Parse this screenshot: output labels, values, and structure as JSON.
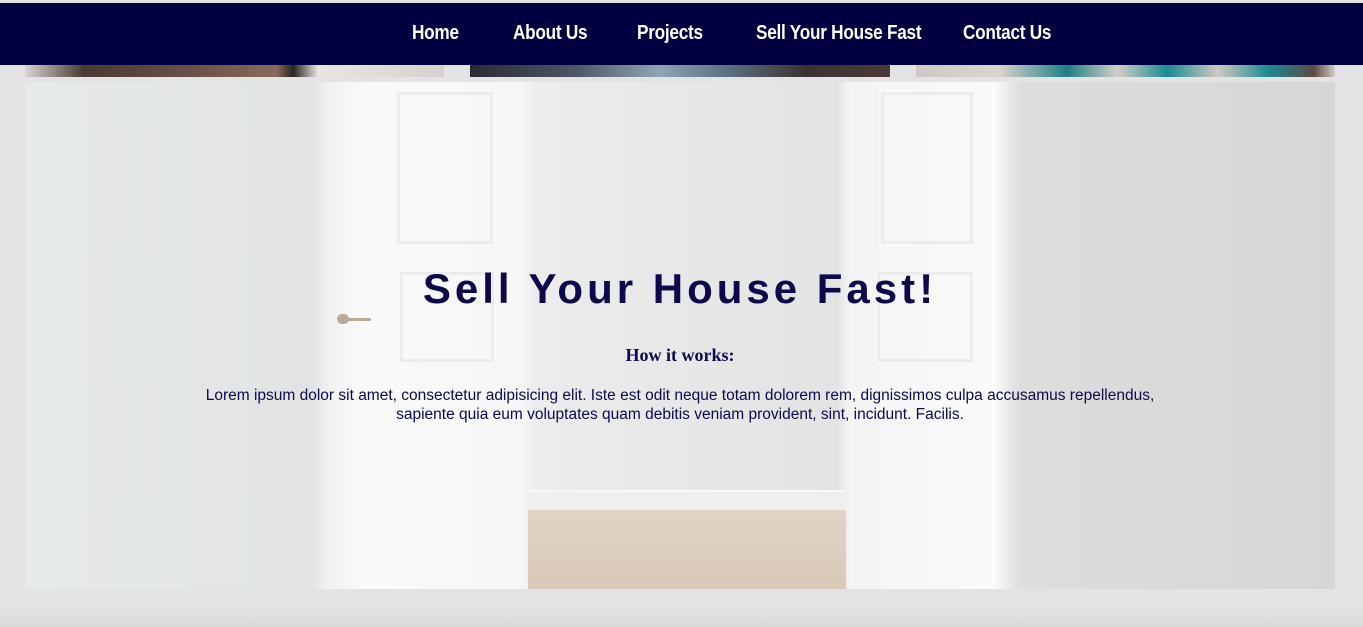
{
  "nav": {
    "items": [
      "Home",
      "About Us",
      "Projects",
      "Sell Your House Fast",
      "Contact Us"
    ]
  },
  "hero": {
    "title": "Sell Your House Fast!",
    "subtitle": "How it works:",
    "text": "Lorem ipsum dolor sit amet, consectetur adipisicing elit. Iste est odit neque totam dolorem rem, dignissimos culpa accusamus repellendus, sapiente quia eum voluptates quam debitis veniam provident, sint, incidunt. Facilis."
  },
  "colors": {
    "navbar": "#020040",
    "heading": "#0c0a4a",
    "nav_text": "#ffffff"
  }
}
